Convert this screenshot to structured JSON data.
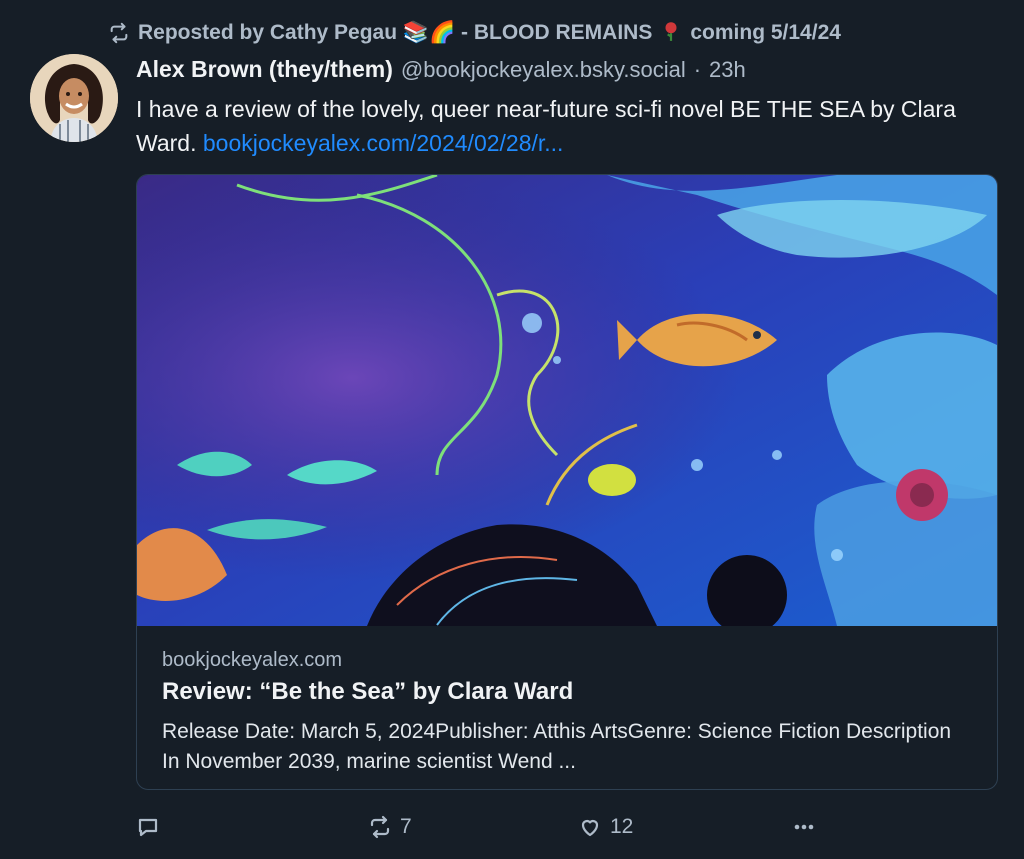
{
  "repost": {
    "text": "Reposted by Cathy Pegau 📚🌈 - BLOOD REMAINS",
    "suffix": "coming 5/14/24",
    "icon": "repost-icon",
    "emoji_icon": "rose-icon"
  },
  "author": {
    "name": "Alex Brown (they/them)",
    "handle": "@bookjockeyalex.bsky.social",
    "separator": "·",
    "age": "23h",
    "avatar": "avatar-icon"
  },
  "post": {
    "text": "I have a review of the lovely, queer near-future sci-fi novel BE THE SEA by Clara Ward.",
    "link_text": "bookjockeyalex.com/2024/02/28/r..."
  },
  "card": {
    "domain": "bookjockeyalex.com",
    "title": "Review: “Be the Sea” by Clara Ward",
    "description": "Release Date: March 5, 2024Publisher: Atthis ArtsGenre: Science Fiction Description In November 2039, marine scientist Wend ..."
  },
  "actions": {
    "reply": {
      "icon": "reply-icon",
      "count": ""
    },
    "repost": {
      "icon": "repost-icon",
      "count": "7"
    },
    "like": {
      "icon": "heart-icon",
      "count": "12"
    },
    "more": {
      "icon": "more-icon"
    }
  },
  "colors": {
    "background": "#161e27",
    "text": "#f1f3f5",
    "muted": "#aebbc9",
    "link": "#208bfe",
    "border": "#2e4052"
  }
}
